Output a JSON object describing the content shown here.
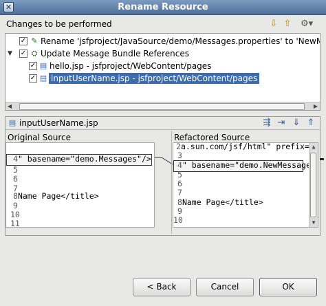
{
  "window": {
    "title": "Rename Resource"
  },
  "changes": {
    "header": "Changes to be performed",
    "toolbar_icons": [
      "next-change-icon",
      "previous-change-icon",
      "view-menu-icon"
    ],
    "items": [
      {
        "text": "Rename 'jsfproject/JavaSource/demo/Messages.properties' to 'NewMessages.pro",
        "checked": "✓",
        "expanded": ""
      },
      {
        "text": "Update Message Bundle References",
        "checked": "✓",
        "expanded": "▼"
      },
      {
        "text": "hello.jsp - jsfproject/WebContent/pages",
        "checked": "✓"
      },
      {
        "text": "inputUserName.jsp - jsfproject/WebContent/pages",
        "checked": "✓",
        "selected": true
      }
    ]
  },
  "compare": {
    "file_title": "inputUserName.jsp",
    "toolbar_icons": [
      "copy-all-left-icon",
      "copy-current-icon",
      "next-difference-icon",
      "previous-difference-icon"
    ],
    "left": {
      "header": "Original Source",
      "lines": [
        {
          "num": "",
          "text": ""
        },
        {
          "num": "4",
          "text": "\" basename=\"demo.Messages\"/>"
        },
        {
          "num": "5",
          "text": ""
        },
        {
          "num": "6",
          "text": ""
        },
        {
          "num": "7",
          "text": ""
        },
        {
          "num": "8",
          "text": "Name Page</title>"
        },
        {
          "num": "9",
          "text": ""
        },
        {
          "num": "10",
          "text": ""
        },
        {
          "num": "11",
          "text": ""
        }
      ]
    },
    "right": {
      "header": "Refactored Source",
      "lines": [
        {
          "num": "2",
          "text": "a.sun.com/jsf/html\" prefix=\""
        },
        {
          "num": "3",
          "text": ""
        },
        {
          "num": "4",
          "text": "\" basename=\"demo.NewMessage"
        },
        {
          "num": "5",
          "text": ""
        },
        {
          "num": "6",
          "text": ""
        },
        {
          "num": "7",
          "text": ""
        },
        {
          "num": "8",
          "text": "Name Page</title>"
        },
        {
          "num": "9",
          "text": ""
        },
        {
          "num": "10",
          "text": ""
        }
      ]
    }
  },
  "buttons": {
    "back": "< Back",
    "cancel": "Cancel",
    "ok": "OK"
  }
}
